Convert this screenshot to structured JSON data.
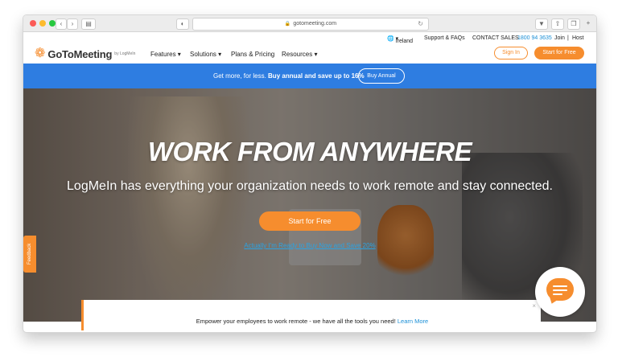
{
  "browser": {
    "url": "gotomeeting.com",
    "lock_icon": "lock-icon",
    "reload_icon": "reload-icon"
  },
  "utility_nav": {
    "region": "Ireland",
    "support": "Support & FAQs",
    "contact_label": "CONTACT SALES",
    "phone": "1800 94 3635",
    "join": "Join",
    "separator": "|",
    "host": "Host"
  },
  "brand": {
    "name": "GoToMeeting",
    "by": "by LogMeIn",
    "color": "#f68d2e"
  },
  "main_nav": {
    "items": [
      "Features",
      "Solutions",
      "Plans & Pricing",
      "Resources"
    ],
    "signin": "Sign In",
    "start": "Start for Free"
  },
  "promo": {
    "lead": "Get more, for less. ",
    "bold": "Buy annual and save up to 16%",
    "button": "Buy Annual",
    "color": "#2e7de1"
  },
  "hero": {
    "headline": "WORK FROM ANYWHERE",
    "sub": "LogMeIn has everything your organization needs to work remote and stay connected.",
    "cta": "Start for Free",
    "ready_link": "Actually I'm Ready to Buy Now and Save 20%"
  },
  "feedback": {
    "label": "Feedback"
  },
  "bottom_banner": {
    "text": "Empower your employees to work remote - we have all the tools you need! ",
    "link": "Learn More"
  }
}
